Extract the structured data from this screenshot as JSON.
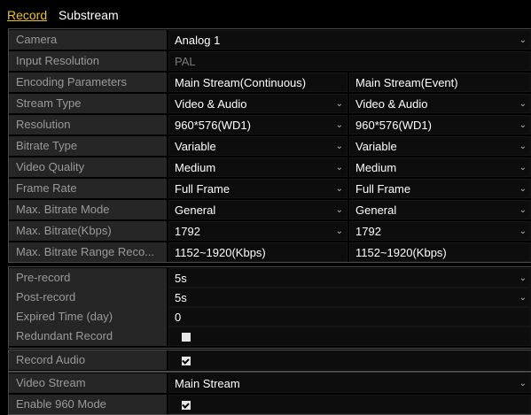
{
  "tabs": [
    {
      "label": "Record",
      "active": true
    },
    {
      "label": "Substream",
      "active": false
    }
  ],
  "icons": {
    "dropdown": "chevron-down-icon",
    "checkbox": "checkbox-icon"
  },
  "colors": {
    "active_tab": "#f0c419",
    "label_bg": "#262626",
    "label_text": "#9a9a9a"
  },
  "camera": {
    "label": "Camera",
    "value": "Analog 1"
  },
  "input_resolution": {
    "label": "Input Resolution",
    "value": "PAL"
  },
  "encoding": {
    "label": "Encoding Parameters",
    "col1": "Main Stream(Continuous)",
    "col2": "Main Stream(Event)"
  },
  "stream_type": {
    "label": "Stream Type",
    "col1": "Video & Audio",
    "col2": "Video & Audio"
  },
  "resolution": {
    "label": "Resolution",
    "col1": "960*576(WD1)",
    "col2": "960*576(WD1)"
  },
  "bitrate_type": {
    "label": "Bitrate Type",
    "col1": "Variable",
    "col2": "Variable"
  },
  "video_quality": {
    "label": "Video Quality",
    "col1": "Medium",
    "col2": "Medium"
  },
  "frame_rate": {
    "label": "Frame Rate",
    "col1": "Full Frame",
    "col2": "Full Frame"
  },
  "max_bitrate_mode": {
    "label": "Max. Bitrate Mode",
    "col1": "General",
    "col2": "General"
  },
  "max_bitrate": {
    "label": "Max. Bitrate(Kbps)",
    "col1": "1792",
    "col2": "1792"
  },
  "max_bitrate_range": {
    "label": "Max. Bitrate Range Reco...",
    "col1": "1152~1920(Kbps)",
    "col2": "1152~1920(Kbps)"
  },
  "pre_record": {
    "label": "Pre-record",
    "value": "5s"
  },
  "post_record": {
    "label": "Post-record",
    "value": "5s"
  },
  "expired_time": {
    "label": "Expired Time (day)",
    "value": "0"
  },
  "redundant_record": {
    "label": "Redundant Record",
    "checked": false
  },
  "record_audio": {
    "label": "Record Audio",
    "checked": true
  },
  "video_stream": {
    "label": "Video Stream",
    "value": "Main Stream"
  },
  "enable_960": {
    "label": "Enable 960 Mode",
    "checked": true
  }
}
